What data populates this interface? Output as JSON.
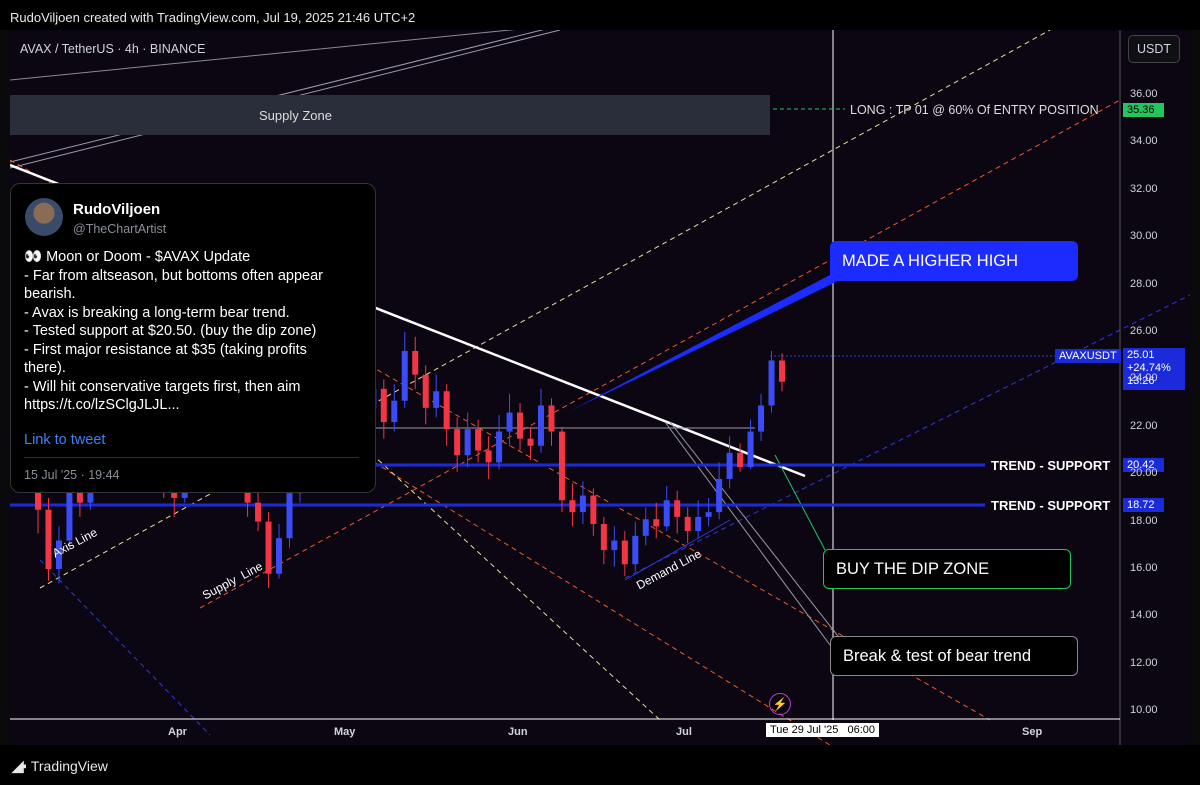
{
  "header": {
    "text": "RudoViljoen created with TradingView.com, Jul 19, 2025 21:46 UTC+2"
  },
  "footer": {
    "brand": "TradingView"
  },
  "chart_data": {
    "type": "candlestick",
    "symbol": "AVAX / TetherUS · 4h · BINANCE",
    "currency_button": "USDT",
    "ylim": [
      10,
      37
    ],
    "y_ticks": [
      "10.00",
      "12.00",
      "14.00",
      "16.00",
      "18.00",
      "20.00",
      "22.00",
      "24.00",
      "26.00",
      "28.00",
      "30.00",
      "32.00",
      "34.00",
      "36.00"
    ],
    "x_ticks": [
      "Apr",
      "May",
      "Jun",
      "Jul",
      "Sep"
    ],
    "crosshair_date": "Tue 29 Jul '25   06:00",
    "price_tag": {
      "symbol": "AVAXUSDT",
      "price": "25.01",
      "change": "+24.74%",
      "countdown": "13:26"
    },
    "levels": [
      {
        "label": "TREND - SUPPORT",
        "value": "20.42",
        "color": "#1c2bd9"
      },
      {
        "label": "TREND - SUPPORT",
        "value": "18.72",
        "color": "#1c2bd9"
      },
      {
        "label": "LONG : TP 01 @ 60% Of ENTRY POSITION",
        "value": "35.36",
        "color": "#22c55e"
      }
    ],
    "zones": [
      {
        "label": "Supply Zone",
        "from": 34.5,
        "to": 36.2
      }
    ],
    "line_labels": [
      "Axis Line",
      "Supply  Line",
      "Demand Line"
    ],
    "callouts": [
      "MADE A HIGHER HIGH",
      "BUY THE DIP ZONE",
      "Break & test of bear trend"
    ],
    "colors": {
      "up": "#3b4cf5",
      "down": "#f23645",
      "support": "#1c2bd9",
      "tp": "#22c55e"
    },
    "candles": [
      [
        20,
        18.5,
        21,
        17.5
      ],
      [
        18.5,
        16,
        19,
        15.5
      ],
      [
        16,
        17.2,
        17.8,
        15.4
      ],
      [
        17.2,
        19.5,
        20,
        16.8
      ],
      [
        19.5,
        18.8,
        21,
        18.2
      ],
      [
        18.8,
        20.2,
        21.5,
        18.5
      ],
      [
        20.2,
        21.8,
        22.6,
        19.8
      ],
      [
        21.8,
        20.8,
        22.5,
        20.2
      ],
      [
        20.8,
        22.4,
        23.5,
        20.5
      ],
      [
        22.4,
        21.5,
        23.4,
        20.8
      ],
      [
        21.5,
        22.8,
        23.8,
        21
      ],
      [
        22.8,
        20.2,
        23.2,
        19.6
      ],
      [
        20.2,
        19.6,
        21.2,
        19
      ],
      [
        19.6,
        19,
        20.8,
        18.2
      ],
      [
        19,
        21.2,
        22.5,
        18.8
      ],
      [
        21.2,
        22.6,
        24,
        20.8
      ],
      [
        22.6,
        21.4,
        23.4,
        20.9
      ],
      [
        21.4,
        20.8,
        22.2,
        20.2
      ],
      [
        20.8,
        22,
        22.8,
        20.3
      ],
      [
        22,
        21.2,
        22.6,
        19.9
      ],
      [
        21.2,
        18.8,
        21.5,
        18.2
      ],
      [
        18.8,
        18,
        19.5,
        17.6
      ],
      [
        18,
        15.8,
        18.4,
        15.2
      ],
      [
        15.8,
        17.3,
        17.9,
        15.6
      ],
      [
        17.3,
        19.2,
        19.8,
        16.9
      ],
      [
        19.2,
        20.8,
        21.6,
        18.8
      ],
      [
        20.8,
        22.4,
        23.1,
        20.2
      ],
      [
        22.4,
        21.2,
        23.6,
        20.8
      ],
      [
        21.2,
        23.5,
        24.2,
        20.9
      ],
      [
        23.5,
        25.5,
        26.2,
        23
      ],
      [
        25.5,
        24.2,
        26.8,
        23.8
      ],
      [
        24.2,
        22.8,
        24.8,
        22.2
      ],
      [
        22.8,
        23.6,
        24.3,
        22.5
      ],
      [
        23.6,
        22.2,
        24,
        21.5
      ],
      [
        22.2,
        23.1,
        23.8,
        21.8
      ],
      [
        23.1,
        25.2,
        26,
        22.8
      ],
      [
        25.2,
        24.2,
        25.8,
        23.6
      ],
      [
        24.2,
        22.8,
        24.6,
        22.1
      ],
      [
        22.8,
        23.5,
        24.2,
        22.4
      ],
      [
        23.5,
        21.9,
        23.8,
        21.2
      ],
      [
        21.9,
        20.8,
        22.4,
        20.1
      ],
      [
        20.8,
        21.9,
        22.6,
        20.3
      ],
      [
        21.9,
        21,
        22.3,
        20.5
      ],
      [
        21,
        20.5,
        21.6,
        19.8
      ],
      [
        20.5,
        21.8,
        22.5,
        20.2
      ],
      [
        21.8,
        22.6,
        23.4,
        21.2
      ],
      [
        22.6,
        21.5,
        23,
        21
      ],
      [
        21.5,
        21.2,
        22,
        20.6
      ],
      [
        21.2,
        22.9,
        23.6,
        20.9
      ],
      [
        22.9,
        21.8,
        23.2,
        21.2
      ],
      [
        21.8,
        18.9,
        22,
        18.4
      ],
      [
        18.9,
        18.4,
        19.6,
        17.8
      ],
      [
        18.4,
        19.1,
        19.7,
        17.9
      ],
      [
        19.1,
        17.9,
        19.4,
        17.4
      ],
      [
        17.9,
        16.8,
        18.2,
        16.2
      ],
      [
        16.8,
        17.2,
        17.8,
        16.1
      ],
      [
        17.2,
        16.2,
        17.6,
        15.7
      ],
      [
        16.2,
        17.4,
        18,
        15.9
      ],
      [
        17.4,
        18.1,
        18.6,
        17
      ],
      [
        18.1,
        17.8,
        18.8,
        17.3
      ],
      [
        17.8,
        18.9,
        19.5,
        17.6
      ],
      [
        18.9,
        18.2,
        19.3,
        17.5
      ],
      [
        18.2,
        17.6,
        18.6,
        17.1
      ],
      [
        17.6,
        18.2,
        18.9,
        17.3
      ],
      [
        18.2,
        18.4,
        19,
        17.8
      ],
      [
        18.4,
        19.8,
        20.5,
        18.1
      ],
      [
        19.8,
        20.9,
        21.6,
        19.4
      ],
      [
        20.9,
        20.3,
        21.3,
        20.1
      ],
      [
        20.3,
        21.8,
        22.3,
        20.2
      ],
      [
        21.8,
        22.9,
        23.4,
        21.4
      ],
      [
        22.9,
        24.8,
        25.2,
        22.6
      ],
      [
        24.8,
        23.9,
        25.1,
        23.5
      ]
    ]
  }
}
